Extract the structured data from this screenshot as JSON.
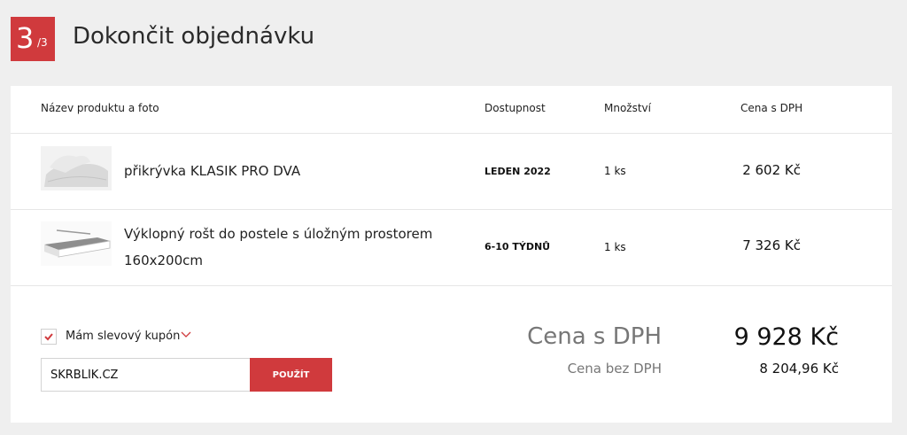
{
  "header": {
    "step_current": "3",
    "step_total": "/3",
    "title": "Dokončit objednávku"
  },
  "table": {
    "columns": [
      "Název produktu a foto",
      "Dostupnost",
      "Množství",
      "Cena s DPH"
    ],
    "rows": [
      {
        "name": "přikrývka KLASIK PRO DVA",
        "name_line2": "",
        "availability": "LEDEN 2022",
        "quantity": "1 ks",
        "price": "2 602 Kč",
        "thumb_icon": "duvet-image"
      },
      {
        "name": "Výklopný rošt do postele s úložným prostorem",
        "name_line2": "160x200cm",
        "availability": "6-10 TÝDNŮ",
        "quantity": "1 ks",
        "price": "7 326 Kč",
        "thumb_icon": "bed-frame-image"
      }
    ]
  },
  "coupon": {
    "label": "Mám slevový kupón",
    "code": "SKRBLÍK.CZ",
    "apply_label": "POUŽÍT",
    "checked": true
  },
  "totals": {
    "with_vat_label": "Cena s DPH",
    "with_vat_value": "9 928 Kč",
    "without_vat_label": "Cena bez DPH",
    "without_vat_value": "8 204,96 Kč"
  },
  "colors": {
    "accent": "#d03a3d",
    "background": "#efefef"
  }
}
